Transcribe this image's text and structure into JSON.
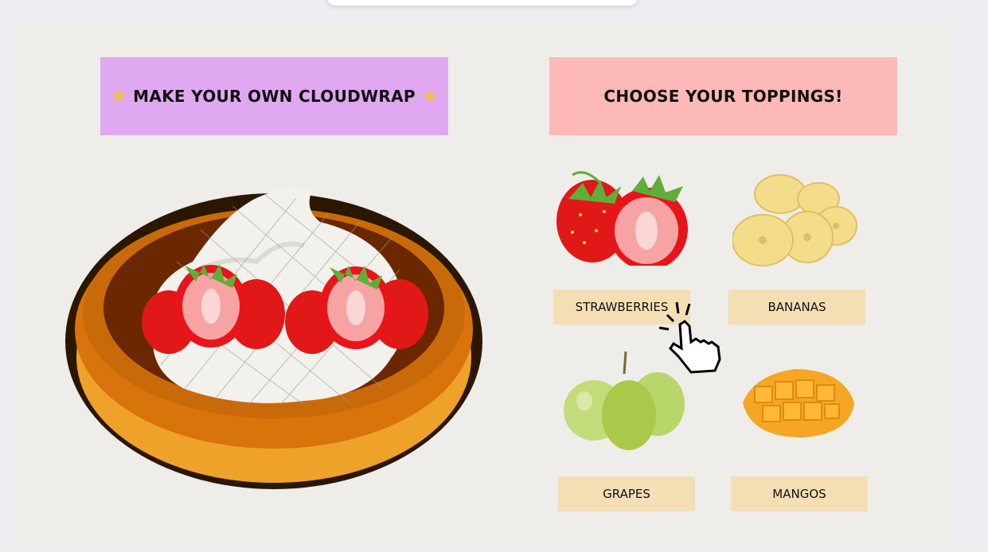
{
  "builder": {
    "title": "MAKE YOUR OWN CLOUDWRAP",
    "title_icon": "star-icon"
  },
  "toppings": {
    "title": "CHOOSE YOUR TOPPINGS!",
    "items": [
      {
        "label": "STRAWBERRIES",
        "icon": "strawberry-icon"
      },
      {
        "label": "BANANAS",
        "icon": "banana-icon"
      },
      {
        "label": "GRAPES",
        "icon": "grape-icon"
      },
      {
        "label": "MANGOS",
        "icon": "mango-icon"
      }
    ]
  },
  "colors": {
    "left_banner": "#e0a8f0",
    "right_banner": "#fdb8b8",
    "label_bg": "#f3dfb3",
    "panel_bg": "#efede9"
  }
}
